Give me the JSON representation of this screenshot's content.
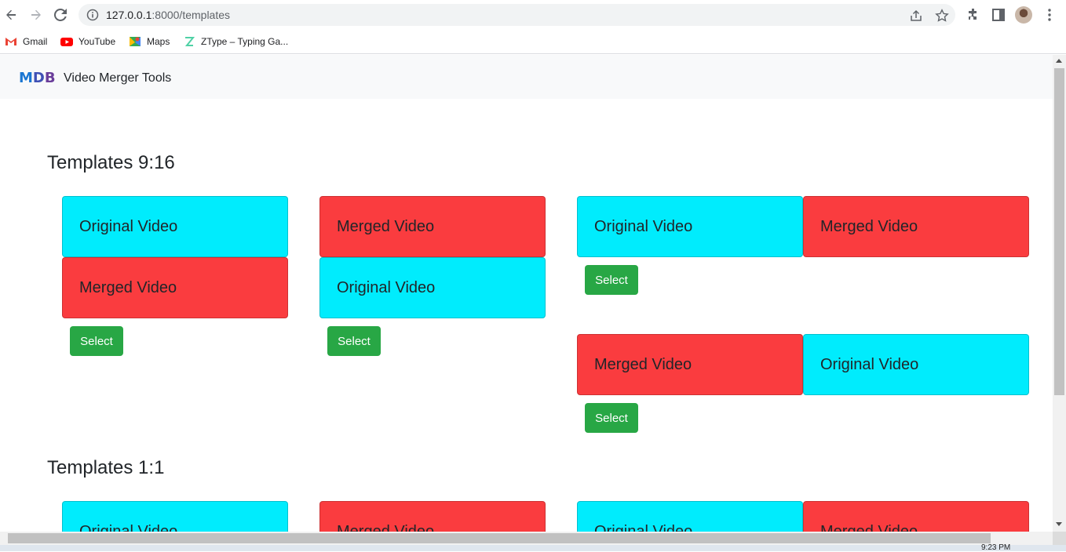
{
  "browser": {
    "url_host": "127.0.0.1",
    "url_path": ":8000/templates",
    "bookmarks": [
      {
        "label": "Gmail",
        "icon": "gmail-icon"
      },
      {
        "label": "YouTube",
        "icon": "youtube-icon"
      },
      {
        "label": "Maps",
        "icon": "maps-icon"
      },
      {
        "label": "ZType – Typing Ga...",
        "icon": "ztype-icon"
      }
    ]
  },
  "navbar": {
    "logo_m": "M",
    "logo_d": "D",
    "logo_b": "B",
    "title": "Video Merger Tools"
  },
  "sections": [
    {
      "title": "Templates 9:16",
      "templates": [
        {
          "tiles": [
            "Original Video",
            "Merged Video"
          ],
          "select_label": "Select"
        },
        {
          "tiles": [
            "Merged Video",
            "Original Video"
          ],
          "select_label": "Select"
        },
        {
          "tiles": [
            "Original Video",
            "Merged Video"
          ],
          "select_label": "Select"
        },
        {
          "tiles": [
            "Merged Video",
            "Original Video"
          ],
          "select_label": "Select"
        }
      ]
    },
    {
      "title": "Templates 1:1",
      "templates": [
        {
          "tiles": [
            "Original Video"
          ]
        },
        {
          "tiles": [
            "Merged Video"
          ]
        },
        {
          "tiles": [
            "Original Video",
            "Merged Video"
          ]
        }
      ]
    }
  ],
  "taskbar": {
    "clock": "9:23 PM"
  },
  "colors": {
    "original": "#00ecfd",
    "merged": "#fa3c3f",
    "select": "#28a745"
  }
}
